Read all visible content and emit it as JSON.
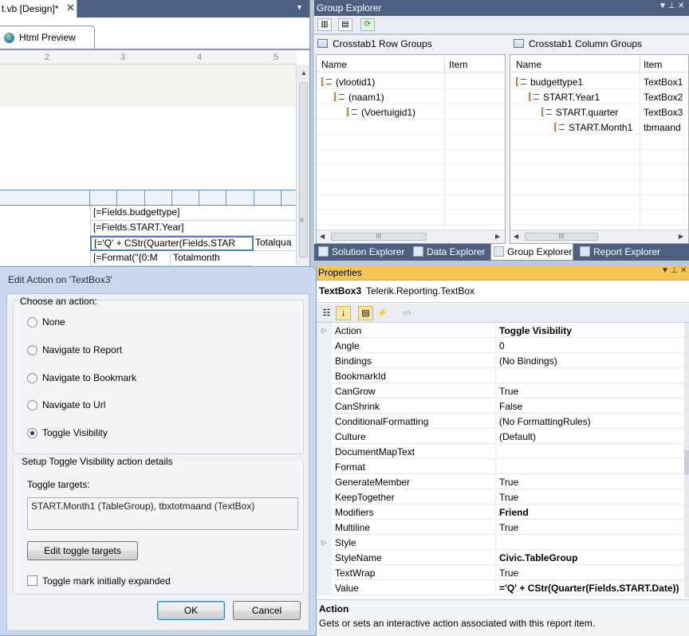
{
  "designer": {
    "doc_tab_title": "t.vb [Design]*",
    "doc_tab_close": "✕",
    "preview_tab": "Html Preview",
    "ruler": [
      "2",
      "3",
      "4",
      "5"
    ],
    "cells": {
      "c1": "[=Fields.budgettype]",
      "c2": "[=Fields.START.Year]",
      "c3": "[='Q' + CStr(Quarter(Fields.STAR",
      "c3b": "Totalqua",
      "c4": "[=Format(\"{0:M",
      "c4b": "Totalmonth"
    }
  },
  "group_explorer": {
    "title": "Group Explorer",
    "row_groups_title": "Crosstab1 Row Groups",
    "col_groups_title": "Crosstab1 Column Groups",
    "col_name": "Name",
    "col_item": "Item",
    "row_groups": [
      {
        "name": "(vlootid1)",
        "item": ""
      },
      {
        "name": "(naam1)",
        "item": ""
      },
      {
        "name": "(Voertuigid1)",
        "item": ""
      }
    ],
    "col_groups": [
      {
        "name": "budgettype1",
        "item": "TextBox1"
      },
      {
        "name": "START.Year1",
        "item": "TextBox2"
      },
      {
        "name": "START.quarter",
        "item": "TextBox3"
      },
      {
        "name": "START.Month1",
        "item": "tbmaand"
      }
    ],
    "bottom_tabs": [
      "Solution Explorer",
      "Data Explorer",
      "Group Explorer",
      "Report Explorer"
    ]
  },
  "properties": {
    "title": "Properties",
    "object_name": "TextBox3",
    "object_type": "Telerik.Reporting.TextBox",
    "rows": [
      {
        "k": "Action",
        "v": "Toggle Visibility",
        "bold": true,
        "expand": true
      },
      {
        "k": "Angle",
        "v": "0"
      },
      {
        "k": "Bindings",
        "v": "(No Bindings)"
      },
      {
        "k": "BookmarkId",
        "v": ""
      },
      {
        "k": "CanGrow",
        "v": "True"
      },
      {
        "k": "CanShrink",
        "v": "False"
      },
      {
        "k": "ConditionalFormatting",
        "v": "(No FormattingRules)"
      },
      {
        "k": "Culture",
        "v": "(Default)"
      },
      {
        "k": "DocumentMapText",
        "v": ""
      },
      {
        "k": "Format",
        "v": ""
      },
      {
        "k": "GenerateMember",
        "v": "True"
      },
      {
        "k": "KeepTogether",
        "v": "True"
      },
      {
        "k": "Modifiers",
        "v": "Friend",
        "bold": true
      },
      {
        "k": "Multiline",
        "v": "True"
      },
      {
        "k": "Style",
        "v": "",
        "expand": true
      },
      {
        "k": "StyleName",
        "v": "Civic.TableGroup",
        "bold": true
      },
      {
        "k": "TextWrap",
        "v": "True"
      },
      {
        "k": "Value",
        "v": "='Q' + CStr(Quarter(Fields.START.Date))",
        "bold": true
      }
    ],
    "desc_title": "Action",
    "desc_text": "Gets or sets an interactive action associated with this report item."
  },
  "dialog": {
    "title": "Edit Action on 'TextBox3'",
    "choose_label": "Choose an action:",
    "options": [
      "None",
      "Navigate to Report",
      "Navigate to Bookmark",
      "Navigate to Url",
      "Toggle Visibility"
    ],
    "selected_index": 4,
    "setup_label": "Setup Toggle Visibility action details",
    "targets_label": "Toggle targets:",
    "targets_value": "START.Month1 (TableGroup), tbxtotmaand (TextBox)",
    "edit_targets_button": "Edit toggle targets",
    "initially_expanded_label": "Toggle mark initially expanded",
    "initially_expanded": false,
    "ok": "OK",
    "cancel": "Cancel"
  }
}
